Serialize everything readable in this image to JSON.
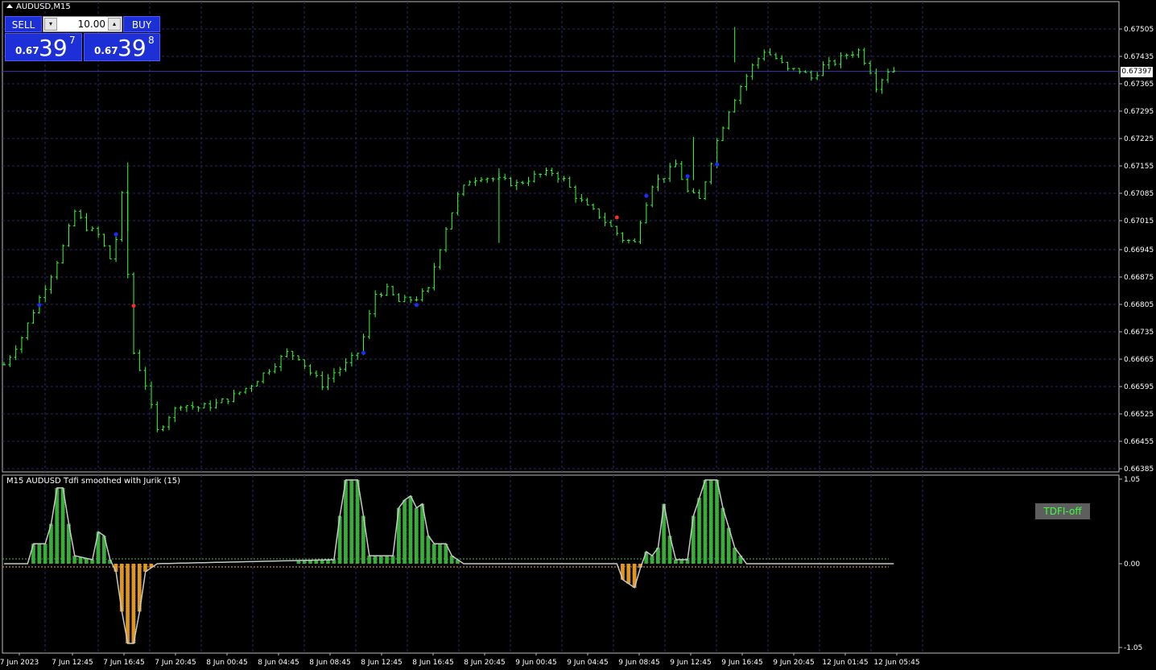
{
  "window": {
    "title": "AUDUSD,M15"
  },
  "trade_panel": {
    "sell_label": "SELL",
    "buy_label": "BUY",
    "lot_value": "10.00",
    "sell_price_prefix": "0.67",
    "sell_price_big": "39",
    "sell_price_sup": "7",
    "buy_price_prefix": "0.67",
    "buy_price_big": "39",
    "buy_price_sup": "8"
  },
  "current_price_label": "0.67397",
  "indicator": {
    "title": "M15 AUDUSD Tdfi smoothed with Jurik (15)",
    "badge": "TDFI-off"
  },
  "colors": {
    "candle": "#33ff33",
    "grid": "#2a2a6a",
    "indicator_up": "#3fbf3f",
    "indicator_down": "#f5a623",
    "indicator_line": "#c8c8c8",
    "dot_blue": "#1a2cff",
    "dot_red": "#ff2a2a"
  },
  "chart_data": [
    {
      "type": "candlestick",
      "title": "AUDUSD,M15",
      "y_ticks": [
        "0.67505",
        "0.67435",
        "0.67365",
        "0.67295",
        "0.67225",
        "0.67155",
        "0.67085",
        "0.67015",
        "0.66945",
        "0.66875",
        "0.66805",
        "0.66735",
        "0.66665",
        "0.66595",
        "0.66525",
        "0.66455",
        "0.66385"
      ],
      "x_ticks": [
        "7 Jun 2023",
        "7 Jun 12:45",
        "7 Jun 16:45",
        "7 Jun 20:45",
        "8 Jun 00:45",
        "8 Jun 04:45",
        "8 Jun 08:45",
        "8 Jun 12:45",
        "8 Jun 16:45",
        "8 Jun 20:45",
        "9 Jun 00:45",
        "9 Jun 04:45",
        "9 Jun 08:45",
        "9 Jun 12:45",
        "9 Jun 16:45",
        "9 Jun 20:45",
        "12 Jun 01:45",
        "12 Jun 05:45"
      ],
      "ylim": [
        0.66385,
        0.67535
      ],
      "current_price": 0.67397,
      "close_path": [
        [
          0,
          0.6665
        ],
        [
          3,
          0.6672
        ],
        [
          6,
          0.6682
        ],
        [
          8,
          0.6688
        ],
        [
          10,
          0.6695
        ],
        [
          12,
          0.6704
        ],
        [
          14,
          0.67
        ],
        [
          16,
          0.6698
        ],
        [
          18,
          0.6692
        ],
        [
          19,
          0.6697
        ],
        [
          20,
          0.6708
        ],
        [
          21,
          0.6688
        ],
        [
          22,
          0.6668
        ],
        [
          24,
          0.666
        ],
        [
          26,
          0.6648
        ],
        [
          28,
          0.6652
        ],
        [
          30,
          0.6655
        ],
        [
          33,
          0.6654
        ],
        [
          36,
          0.6655
        ],
        [
          39,
          0.6657
        ],
        [
          42,
          0.666
        ],
        [
          45,
          0.6664
        ],
        [
          48,
          0.6668
        ],
        [
          50,
          0.6667
        ],
        [
          52,
          0.6663
        ],
        [
          54,
          0.666
        ],
        [
          56,
          0.6663
        ],
        [
          58,
          0.6665
        ],
        [
          60,
          0.6668
        ],
        [
          61,
          0.6672
        ],
        [
          63,
          0.6683
        ],
        [
          65,
          0.6684
        ],
        [
          67,
          0.6681
        ],
        [
          70,
          0.6682
        ],
        [
          72,
          0.6684
        ],
        [
          73,
          0.669
        ],
        [
          75,
          0.67
        ],
        [
          77,
          0.6708
        ],
        [
          79,
          0.6712
        ],
        [
          81,
          0.6713
        ],
        [
          84,
          0.6712
        ],
        [
          87,
          0.6711
        ],
        [
          90,
          0.6713
        ],
        [
          93,
          0.6714
        ],
        [
          95,
          0.6712
        ],
        [
          97,
          0.6708
        ],
        [
          99,
          0.6705
        ],
        [
          101,
          0.6703
        ],
        [
          103,
          0.67
        ],
        [
          105,
          0.6697
        ],
        [
          107,
          0.6696
        ],
        [
          108,
          0.6702
        ],
        [
          110,
          0.6711
        ],
        [
          112,
          0.6713
        ],
        [
          114,
          0.6716
        ],
        [
          116,
          0.6709
        ],
        [
          118,
          0.6707
        ],
        [
          119,
          0.6712
        ],
        [
          121,
          0.6722
        ],
        [
          123,
          0.673
        ],
        [
          125,
          0.6736
        ],
        [
          127,
          0.6741
        ],
        [
          129,
          0.6745
        ],
        [
          131,
          0.6743
        ],
        [
          133,
          0.674
        ],
        [
          135,
          0.674
        ],
        [
          137,
          0.6738
        ],
        [
          139,
          0.6741
        ],
        [
          141,
          0.6742
        ],
        [
          143,
          0.6744
        ],
        [
          145,
          0.6745
        ],
        [
          147,
          0.674
        ],
        [
          148,
          0.6736
        ],
        [
          150,
          0.674
        ],
        [
          151,
          0.674
        ]
      ],
      "signal_dots": [
        {
          "x": 6,
          "price": 0.66802,
          "color": "blue"
        },
        {
          "x": 19,
          "price": 0.66982,
          "color": "blue"
        },
        {
          "x": 22,
          "price": 0.668,
          "color": "red"
        },
        {
          "x": 61,
          "price": 0.6668,
          "color": "blue"
        },
        {
          "x": 70,
          "price": 0.66802,
          "color": "blue"
        },
        {
          "x": 104,
          "price": 0.67025,
          "color": "red"
        },
        {
          "x": 109,
          "price": 0.6708,
          "color": "blue"
        },
        {
          "x": 116,
          "price": 0.6713,
          "color": "blue"
        },
        {
          "x": 121,
          "price": 0.6716,
          "color": "blue"
        }
      ]
    },
    {
      "type": "area",
      "title": "M15 AUDUSD Tdfi smoothed with Jurik (15)",
      "y_ticks": [
        "1.05",
        "0.00",
        "-1.05"
      ],
      "ylim": [
        -1.05,
        1.05
      ],
      "levels": [
        0.05,
        -0.05
      ],
      "badge": "TDFI-off",
      "line_path": [
        [
          0,
          0.0
        ],
        [
          4,
          0.0
        ],
        [
          5,
          0.25
        ],
        [
          7,
          0.25
        ],
        [
          8,
          0.5
        ],
        [
          9,
          0.95
        ],
        [
          10,
          0.95
        ],
        [
          11,
          0.5
        ],
        [
          12,
          0.1
        ],
        [
          15,
          0.05
        ],
        [
          16,
          0.4
        ],
        [
          17,
          0.35
        ],
        [
          18,
          0.05
        ],
        [
          19,
          -0.1
        ],
        [
          20,
          -0.6
        ],
        [
          21,
          -1.0
        ],
        [
          22,
          -1.0
        ],
        [
          23,
          -0.6
        ],
        [
          24,
          -0.1
        ],
        [
          26,
          0.0
        ],
        [
          56,
          0.05
        ],
        [
          57,
          0.6
        ],
        [
          58,
          1.05
        ],
        [
          60,
          1.05
        ],
        [
          61,
          0.6
        ],
        [
          62,
          0.1
        ],
        [
          66,
          0.1
        ],
        [
          67,
          0.7
        ],
        [
          68,
          0.8
        ],
        [
          69,
          0.85
        ],
        [
          70,
          0.7
        ],
        [
          71,
          0.75
        ],
        [
          72,
          0.35
        ],
        [
          73,
          0.25
        ],
        [
          75,
          0.25
        ],
        [
          76,
          0.1
        ],
        [
          78,
          0.0
        ],
        [
          104,
          0.0
        ],
        [
          105,
          -0.2
        ],
        [
          107,
          -0.3
        ],
        [
          108,
          -0.05
        ],
        [
          109,
          0.15
        ],
        [
          110,
          0.1
        ],
        [
          111,
          0.2
        ],
        [
          112,
          0.75
        ],
        [
          113,
          0.35
        ],
        [
          114,
          0.05
        ],
        [
          116,
          0.05
        ],
        [
          117,
          0.6
        ],
        [
          119,
          1.05
        ],
        [
          121,
          1.05
        ],
        [
          122,
          0.7
        ],
        [
          124,
          0.2
        ],
        [
          126,
          0.0
        ],
        [
          151,
          0.0
        ]
      ]
    }
  ]
}
